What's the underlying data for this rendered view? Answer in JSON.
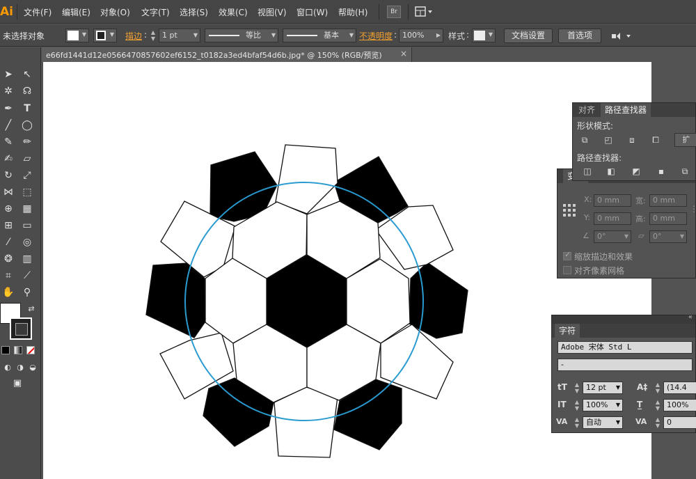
{
  "app": {
    "logo": "Ai"
  },
  "menu": {
    "items": [
      "文件(F)",
      "编辑(E)",
      "对象(O)",
      "文字(T)",
      "选择(S)",
      "效果(C)",
      "视图(V)",
      "窗口(W)",
      "帮助(H)"
    ],
    "bridge_label": "Br"
  },
  "control_bar": {
    "selection_status": "未选择对象",
    "stroke_label": "描边",
    "stroke_weight": "1 pt",
    "profile_uniform": "等比",
    "brush_basic": "基本",
    "opacity_label": "不透明度",
    "opacity_value": "100%",
    "style_label": "样式",
    "document_setup_button": "文档设置",
    "preferences_button": "首选项"
  },
  "document": {
    "tab_title": "e66fd1441d12e0566470857602ef6152_t0182a3ed4bfaf54d6b.jpg* @ 150% (RGB/预览)",
    "close_glyph": "×"
  },
  "align_panel": {
    "tabs": [
      "对齐",
      "路径查找器"
    ],
    "shape_modes_label": "形状模式:",
    "pathfinders_label": "路径查找器:",
    "expand_button": "扩"
  },
  "transform_panel": {
    "title": "变换",
    "x_label": "X:",
    "x_value": "0 mm",
    "y_label": "Y:",
    "y_value": "0 mm",
    "w_label": "宽:",
    "w_value": "0 mm",
    "h_label": "高:",
    "h_value": "0 mm",
    "rotate_value": "0°",
    "shear_value": "0°",
    "scale_strokes_label": "缩放描边和效果",
    "align_pixel_grid_label": "对齐像素网格"
  },
  "character_panel": {
    "title": "字符",
    "font_family": "Adobe 宋体 Std L",
    "font_style": "-",
    "font_size": "12 pt",
    "leading": "(14.4",
    "vertical_scale": "100%",
    "horizontal_scale": "100%",
    "kerning": "自动",
    "tracking": "0"
  },
  "artwork": {
    "description_colors": {
      "fill_black": "#000000",
      "fill_white": "#ffffff",
      "guide_circle": "#2a9bd0"
    }
  }
}
